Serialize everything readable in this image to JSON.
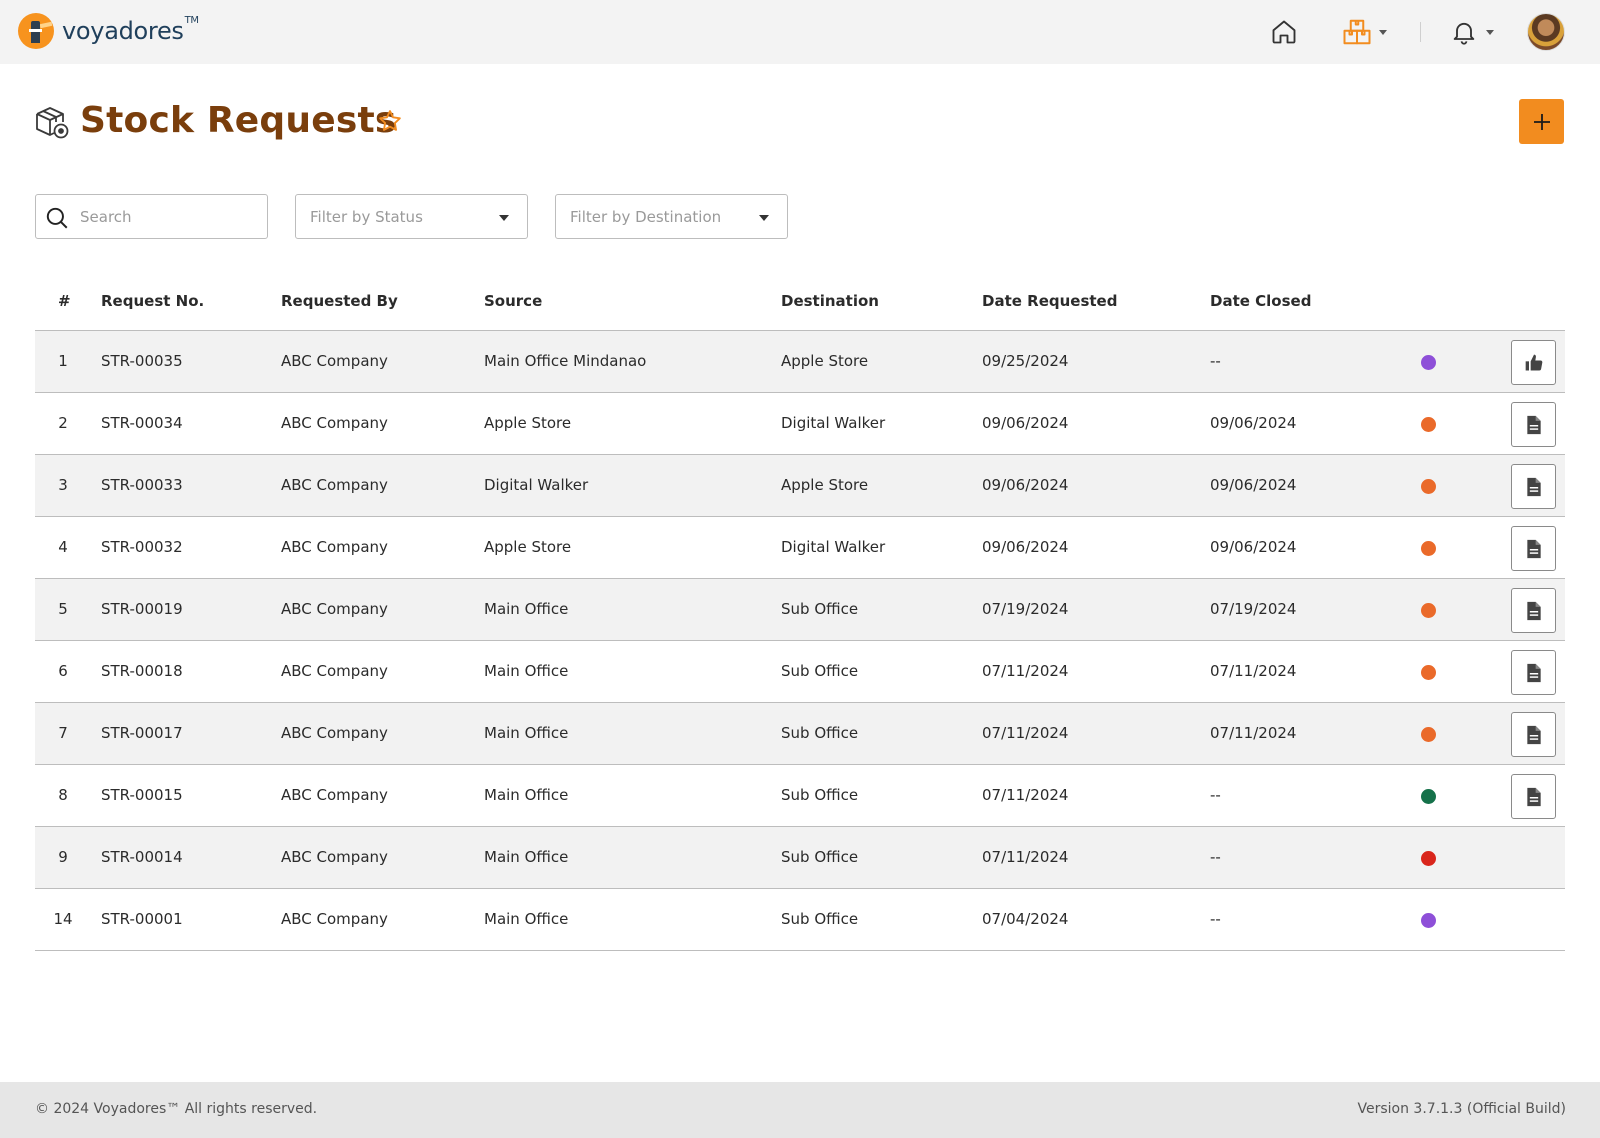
{
  "app": {
    "brand": "voyadores",
    "brand_tm": "TM"
  },
  "nav": {
    "icons": [
      "home-icon",
      "inventory-box-icon",
      "bell-icon"
    ]
  },
  "page": {
    "title": "Stock Requests",
    "title_color": "#7a3e0c",
    "accent_color": "#f28c1f"
  },
  "filters": {
    "search_placeholder": "Search",
    "status_placeholder": "Filter by Status",
    "destination_placeholder": "Filter by Destination"
  },
  "table": {
    "headers": {
      "num": "#",
      "request_no": "Request No.",
      "requested_by": "Requested By",
      "source": "Source",
      "destination": "Destination",
      "date_requested": "Date Requested",
      "date_closed": "Date Closed"
    },
    "rows": [
      {
        "num": "1",
        "request_no": "STR-00035",
        "requested_by": "ABC Company",
        "source": "Main Office Mindanao",
        "destination": "Apple Store",
        "date_requested": "09/25/2024",
        "date_closed": "--",
        "status_color": "#8e4fd8",
        "action": "approve"
      },
      {
        "num": "2",
        "request_no": "STR-00034",
        "requested_by": "ABC Company",
        "source": "Apple Store",
        "destination": "Digital Walker",
        "date_requested": "09/06/2024",
        "date_closed": "09/06/2024",
        "status_color": "#ea6a2a",
        "action": "document"
      },
      {
        "num": "3",
        "request_no": "STR-00033",
        "requested_by": "ABC Company",
        "source": "Digital Walker",
        "destination": "Apple Store",
        "date_requested": "09/06/2024",
        "date_closed": "09/06/2024",
        "status_color": "#ea6a2a",
        "action": "document"
      },
      {
        "num": "4",
        "request_no": "STR-00032",
        "requested_by": "ABC Company",
        "source": "Apple Store",
        "destination": "Digital Walker",
        "date_requested": "09/06/2024",
        "date_closed": "09/06/2024",
        "status_color": "#ea6a2a",
        "action": "document"
      },
      {
        "num": "5",
        "request_no": "STR-00019",
        "requested_by": "ABC Company",
        "source": "Main Office",
        "destination": "Sub Office",
        "date_requested": "07/19/2024",
        "date_closed": "07/19/2024",
        "status_color": "#ea6a2a",
        "action": "document"
      },
      {
        "num": "6",
        "request_no": "STR-00018",
        "requested_by": "ABC Company",
        "source": "Main Office",
        "destination": "Sub Office",
        "date_requested": "07/11/2024",
        "date_closed": "07/11/2024",
        "status_color": "#ea6a2a",
        "action": "document"
      },
      {
        "num": "7",
        "request_no": "STR-00017",
        "requested_by": "ABC Company",
        "source": "Main Office",
        "destination": "Sub Office",
        "date_requested": "07/11/2024",
        "date_closed": "07/11/2024",
        "status_color": "#ea6a2a",
        "action": "document"
      },
      {
        "num": "8",
        "request_no": "STR-00015",
        "requested_by": "ABC Company",
        "source": "Main Office",
        "destination": "Sub Office",
        "date_requested": "07/11/2024",
        "date_closed": "--",
        "status_color": "#15714a",
        "action": "document"
      },
      {
        "num": "9",
        "request_no": "STR-00014",
        "requested_by": "ABC Company",
        "source": "Main Office",
        "destination": "Sub Office",
        "date_requested": "07/11/2024",
        "date_closed": "--",
        "status_color": "#d9261c",
        "action": "none"
      },
      {
        "num": "14",
        "request_no": "STR-00001",
        "requested_by": "ABC Company",
        "source": "Main Office",
        "destination": "Sub Office",
        "date_requested": "07/04/2024",
        "date_closed": "--",
        "status_color": "#8e4fd8",
        "action": "none"
      }
    ]
  },
  "footer": {
    "copyright": "© 2024 Voyadores™ All rights reserved.",
    "version": "Version 3.7.1.3 (Official Build)"
  }
}
